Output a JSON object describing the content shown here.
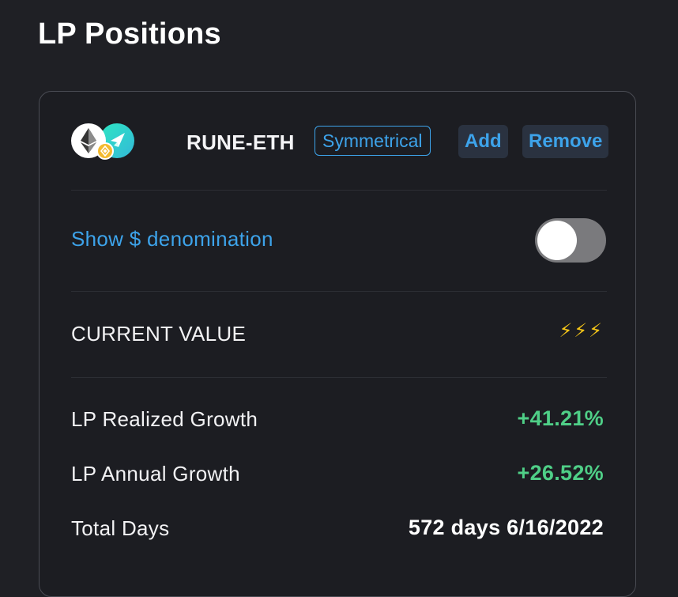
{
  "page": {
    "title": "LP Positions"
  },
  "position": {
    "pool_name": "RUNE-ETH",
    "type_badge": "Symmetrical",
    "add_label": "Add",
    "remove_label": "Remove",
    "asset_icons": [
      "ethereum-icon",
      "thorchain-icon",
      "chain-badge-icon"
    ]
  },
  "toggle": {
    "label": "Show $ denomination",
    "state": "off"
  },
  "current_value": {
    "label": "CURRENT VALUE",
    "value": "⚡⚡⚡"
  },
  "stats": {
    "realized_growth": {
      "label": "LP Realized Growth",
      "value": "+41.21%"
    },
    "annual_growth": {
      "label": "LP Annual Growth",
      "value": "+26.52%"
    },
    "total_days": {
      "label": "Total Days",
      "value": "572 days 6/16/2022"
    }
  },
  "colors": {
    "background": "#1f2025",
    "accent": "#3da3ea",
    "positive": "#4fcf87",
    "card_border": "#4a4c54"
  }
}
